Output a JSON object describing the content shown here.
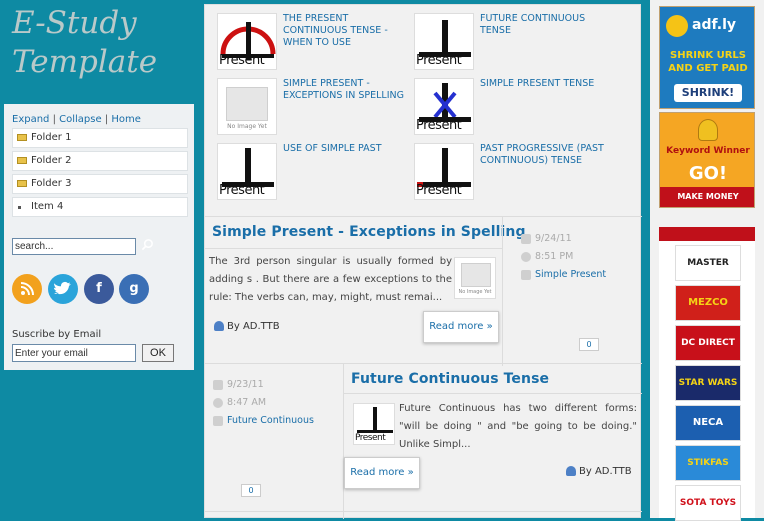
{
  "site": {
    "logo_line1": "E-Study",
    "logo_line2": "Template"
  },
  "sidebar": {
    "tree_links": {
      "expand": "Expand",
      "sep1": " | ",
      "collapse": "Collapse",
      "sep2": " | ",
      "home": "Home"
    },
    "folders": [
      "Folder 1",
      "Folder 2",
      "Folder 3"
    ],
    "item": "Item 4",
    "search": {
      "value": "search..."
    },
    "subscribe_label": "Suscribe by Email",
    "email": {
      "value": "Enter your email",
      "button": "OK"
    }
  },
  "related_posts": [
    {
      "title": "THE PRESENT CONTINUOUS TENSE - WHEN TO USE",
      "thumb": "present"
    },
    {
      "title": "FUTURE CONTINUOUS TENSE",
      "thumb": "present"
    },
    {
      "title": "SIMPLE PRESENT - EXCEPTIONS IN SPELLING",
      "thumb": "noimage"
    },
    {
      "title": "SIMPLE PRESENT TENSE",
      "thumb": "present"
    },
    {
      "title": "USE OF SIMPLE PAST",
      "thumb": "present"
    },
    {
      "title": "PAST PROGRESSIVE (PAST CONTINUOUS) TENSE",
      "thumb": "present"
    }
  ],
  "thumb_text": {
    "present": "Present",
    "noimage": "No Image Yet"
  },
  "posts": [
    {
      "title": "Simple Present - Exceptions in Spelling",
      "body": "The 3rd person singular is usually formed by adding s . But there are a few exceptions to the rule: The verbs can, may, might, must remai...",
      "date": "9/24/11",
      "time": "8:51 PM",
      "label": "Simple Present",
      "author": "By AD.TTB",
      "read_more": "Read more »",
      "comments": "0"
    },
    {
      "title": "Future Continuous Tense",
      "body": "Future Continuous has two different forms: \"will be doing \" and \"be going to be doing.\" Unlike Simpl...",
      "date": "9/23/11",
      "time": "8:47 AM",
      "label": "Future Continuous",
      "author": "By AD.TTB",
      "read_more": "Read more »",
      "comments": "0"
    }
  ],
  "ads": {
    "adfly": {
      "brand": "adf.ly",
      "line1": "SHRINK URLS",
      "line2": "AND GET PAID",
      "cta": "SHRINK!"
    },
    "keyword": {
      "brand": "Keyword Winner",
      "cta": "GO!",
      "sub": "MAKE MONEY"
    },
    "logos": [
      "MASTER",
      "MEZCO",
      "DC DIRECT",
      "STAR WARS",
      "NECA",
      "STIKFAS",
      "SOTA TOYS"
    ]
  },
  "colors": {
    "page_bg": "#0e8aa3",
    "link": "#1a6ea8",
    "banner_red": "#c0101a"
  }
}
